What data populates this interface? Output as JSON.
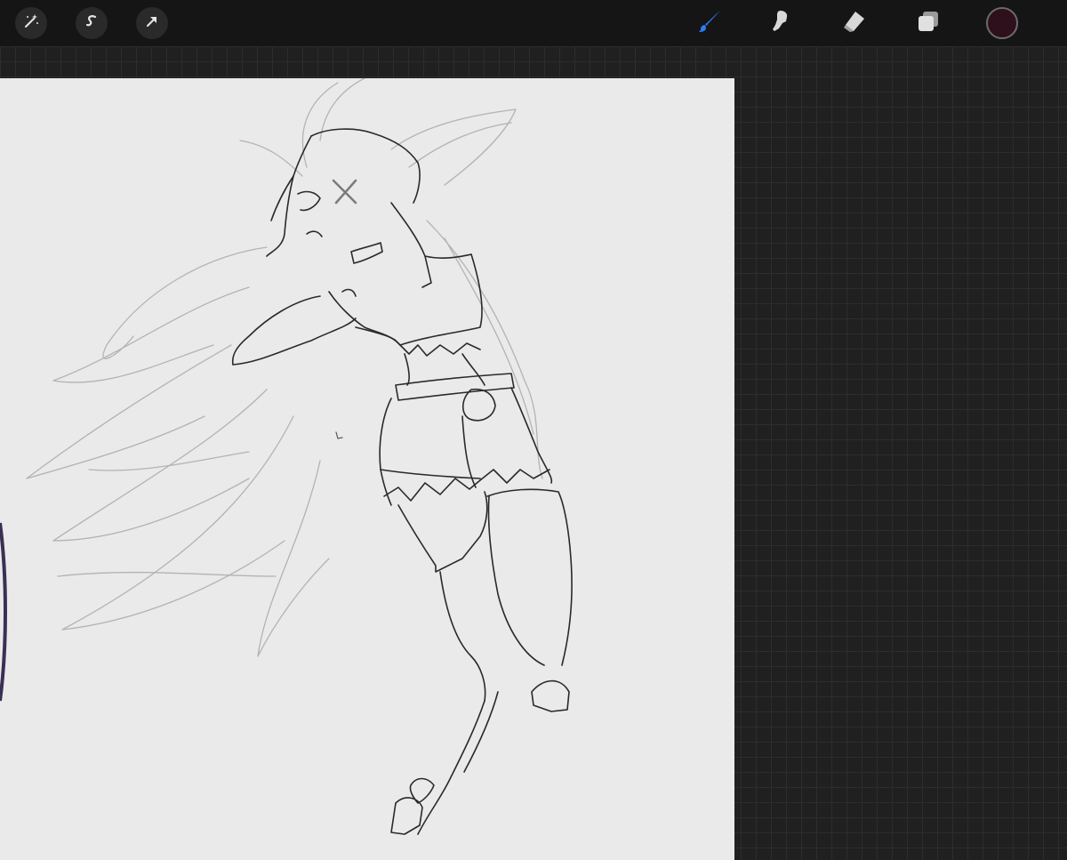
{
  "toolbar": {
    "left_tools": [
      {
        "name": "modify-wand-icon"
      },
      {
        "name": "selection-s-icon"
      },
      {
        "name": "transform-arrow-icon"
      }
    ],
    "right_tools": [
      {
        "name": "brush-icon",
        "active": true
      },
      {
        "name": "smudge-icon",
        "active": false
      },
      {
        "name": "eraser-icon",
        "active": false
      },
      {
        "name": "layers-icon",
        "active": false
      }
    ],
    "active_color": "#2e0f1c"
  },
  "colors": {
    "toolbar_bg": "#151515",
    "workspace_bg": "#202020",
    "canvas_bg": "#eaeaea",
    "active_tool": "#2f7bf5",
    "inactive_tool": "#d8d8d8"
  }
}
